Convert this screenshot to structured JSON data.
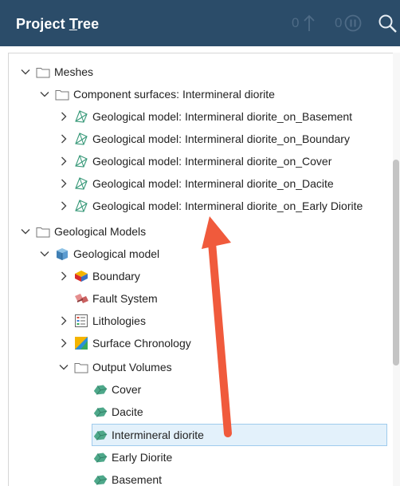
{
  "panel": {
    "title_prefix": "Project ",
    "title_underlined": "T",
    "title_suffix": "ree",
    "pending_count": "0",
    "paused_count": "0"
  },
  "tree": {
    "meshes": "Meshes",
    "component_surfaces": "Component surfaces: Intermineral diorite",
    "mesh_basement": "Geological model: Intermineral diorite_on_Basement",
    "mesh_boundary": "Geological model: Intermineral diorite_on_Boundary",
    "mesh_cover": "Geological model: Intermineral diorite_on_Cover",
    "mesh_dacite": "Geological model: Intermineral diorite_on_Dacite",
    "mesh_early": "Geological model: Intermineral diorite_on_Early Diorite",
    "geological_models": "Geological Models",
    "geological_model": "Geological model",
    "boundary": "Boundary",
    "fault_system": "Fault System",
    "lithologies": "Lithologies",
    "surface_chronology": "Surface Chronology",
    "output_volumes": "Output Volumes",
    "vol_cover": "Cover",
    "vol_dacite": "Dacite",
    "vol_intermineral": "Intermineral diorite",
    "vol_early": "Early Diorite",
    "vol_basement": "Basement"
  },
  "colors": {
    "header_bg": "#2b4c69",
    "selection_bg": "#e3f1fb",
    "selection_border": "#9fcbed",
    "annotation_arrow": "#f05a3c",
    "volume_icon": "#4ea88a",
    "mesh_icon": "#3a9a7a"
  },
  "icons": {
    "header": [
      "arrow-up-icon",
      "pause-icon",
      "search-icon"
    ],
    "tree": [
      "chevron-down-icon",
      "chevron-right-icon",
      "folder-icon",
      "mesh-icon",
      "geological-model-icon",
      "boundary-icon",
      "fault-system-icon",
      "lithologies-icon",
      "surface-chronology-icon",
      "volume-icon"
    ]
  }
}
